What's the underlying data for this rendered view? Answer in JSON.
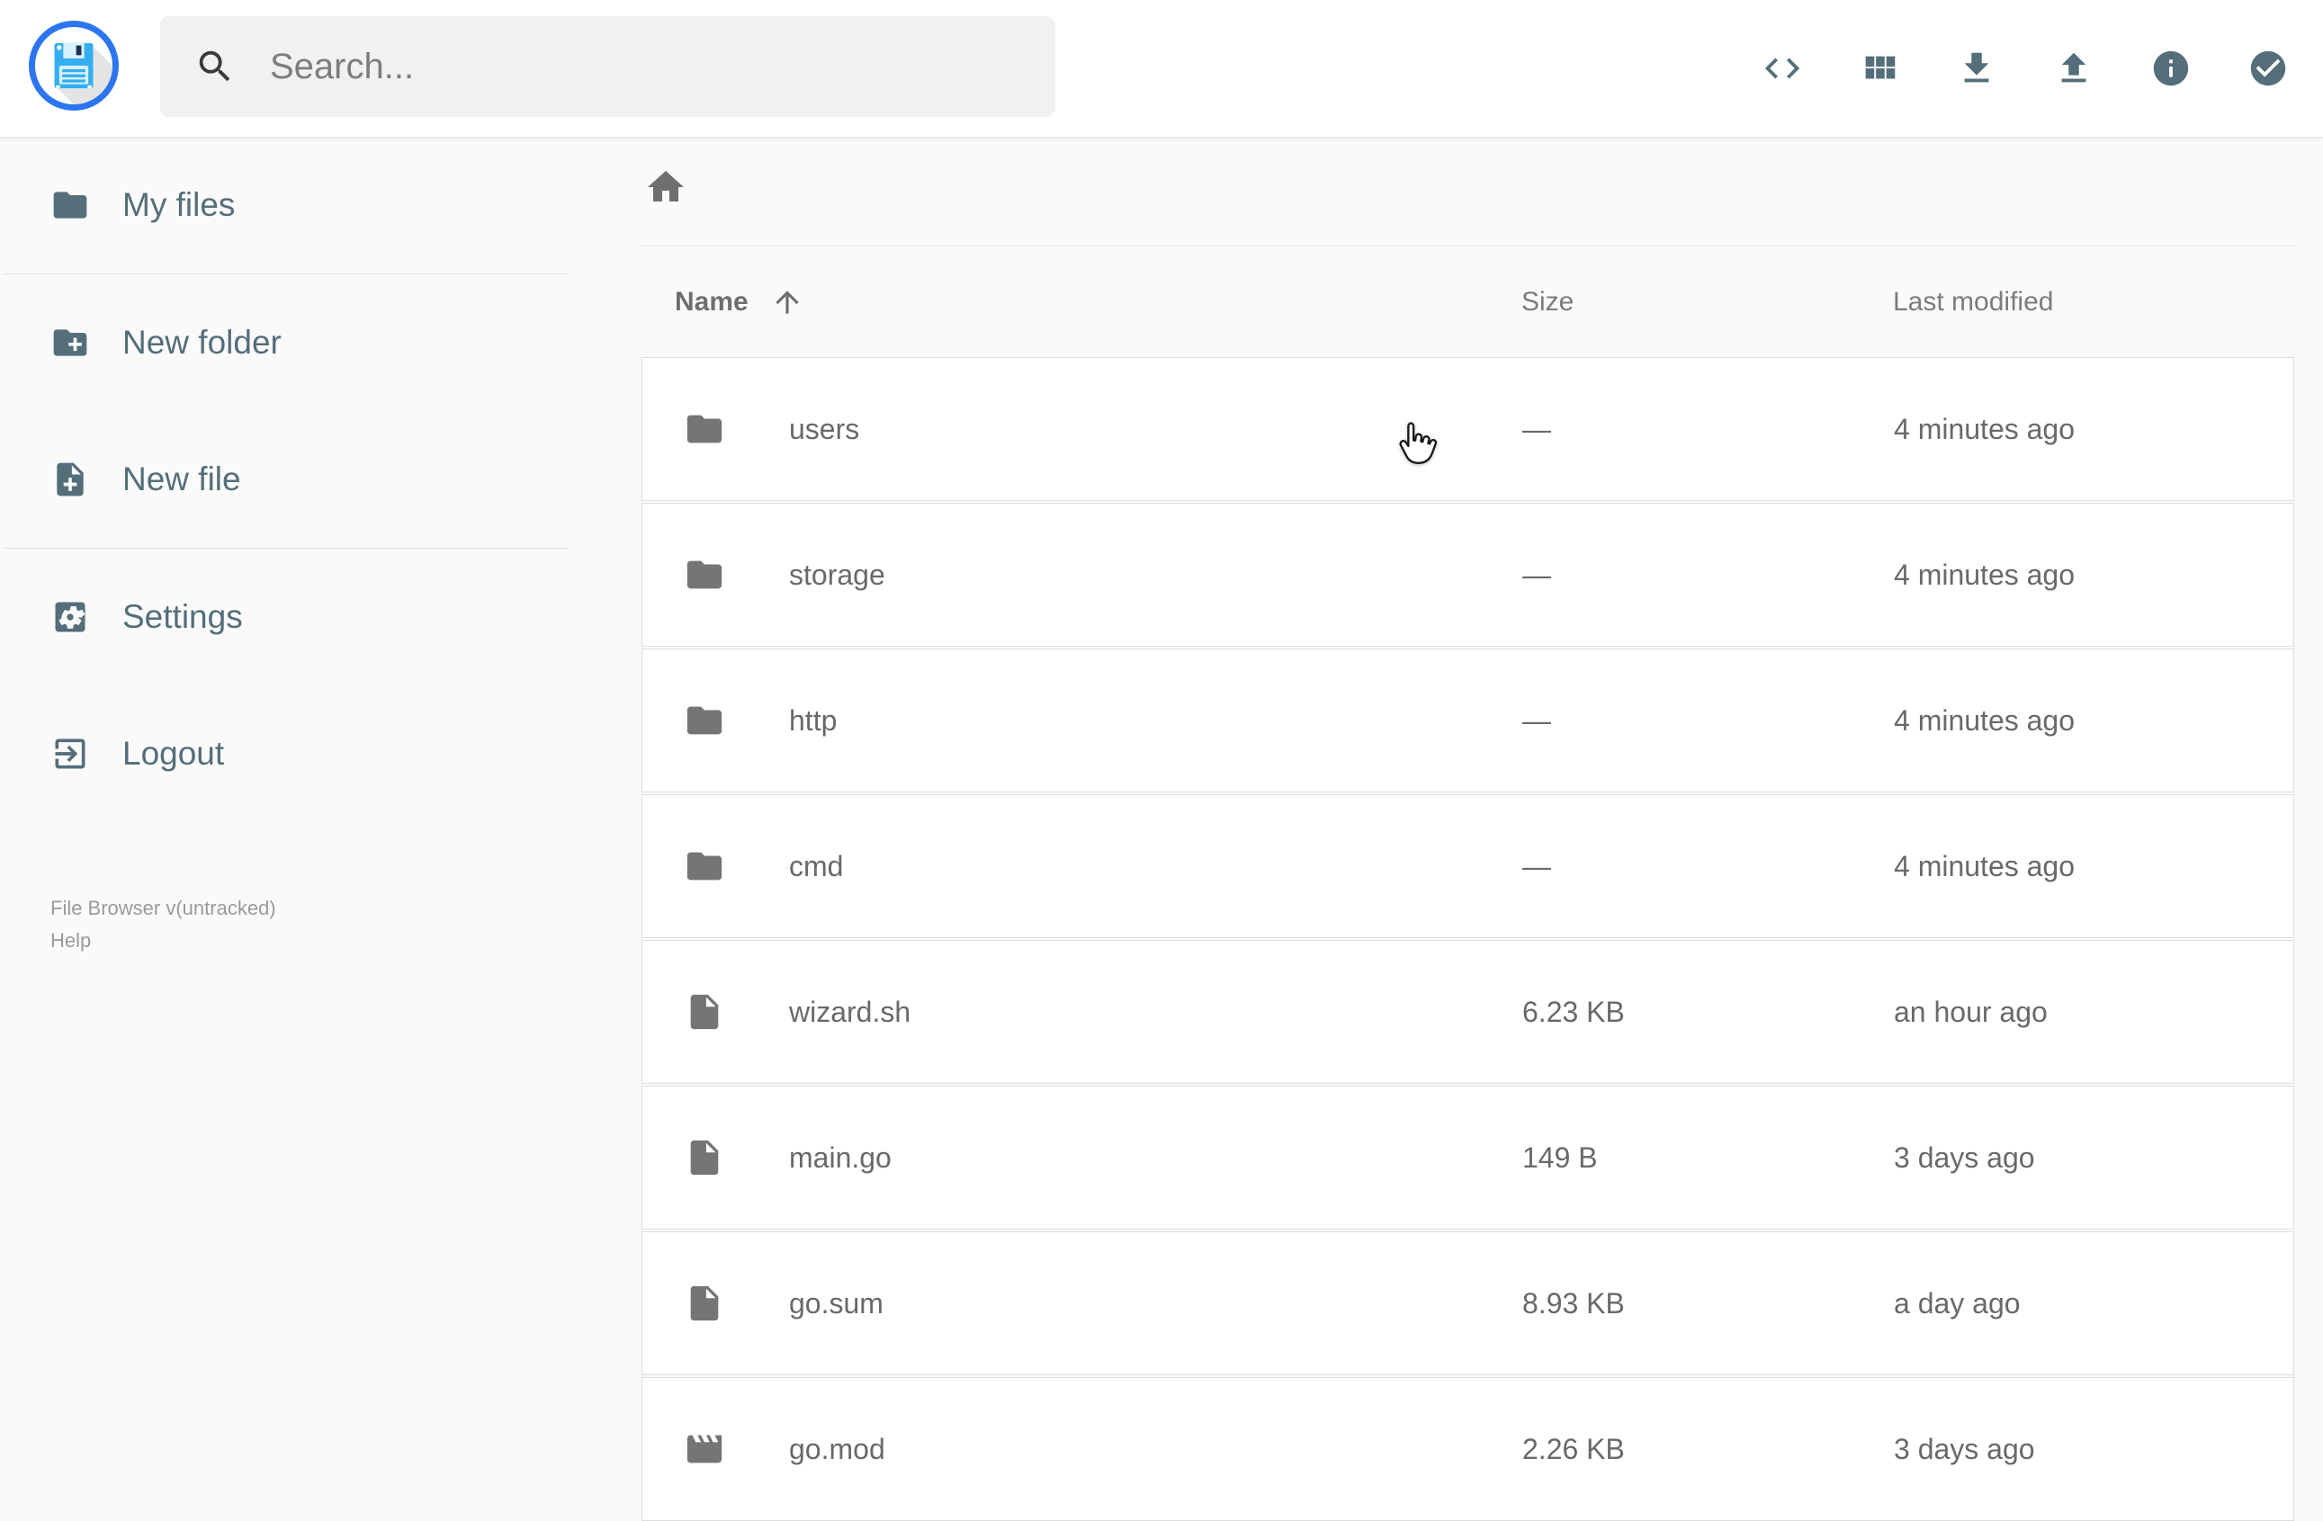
{
  "app": {
    "title": "File Browser"
  },
  "topbar": {
    "search": {
      "placeholder": "Search...",
      "icon": "search-icon"
    },
    "actions": [
      {
        "name": "code-view",
        "icon": "code-icon"
      },
      {
        "name": "switch-view",
        "icon": "grid-view-icon"
      },
      {
        "name": "download",
        "icon": "download-icon"
      },
      {
        "name": "upload",
        "icon": "upload-icon"
      },
      {
        "name": "info",
        "icon": "info-icon"
      },
      {
        "name": "select-multiple",
        "icon": "check-circle-icon"
      }
    ]
  },
  "sidebar": {
    "items": [
      {
        "label": "My files",
        "icon": "folder-icon"
      },
      {
        "label": "New folder",
        "icon": "new-folder-icon"
      },
      {
        "label": "New file",
        "icon": "new-file-icon"
      },
      {
        "label": "Settings",
        "icon": "settings-icon"
      },
      {
        "label": "Logout",
        "icon": "logout-icon"
      }
    ],
    "footer": {
      "version": "File Browser v(untracked)",
      "help_label": "Help"
    }
  },
  "main": {
    "breadcrumb": {
      "home_icon": "home-icon"
    },
    "listing": {
      "columns": [
        {
          "label": "Name",
          "sort": "asc"
        },
        {
          "label": "Size",
          "sort": null
        },
        {
          "label": "Last modified",
          "sort": null
        }
      ],
      "rows": [
        {
          "name": "users",
          "icon": "folder-icon",
          "size": "—",
          "modified": "4 minutes ago"
        },
        {
          "name": "storage",
          "icon": "folder-icon",
          "size": "—",
          "modified": "4 minutes ago"
        },
        {
          "name": "http",
          "icon": "folder-icon",
          "size": "—",
          "modified": "4 minutes ago"
        },
        {
          "name": "cmd",
          "icon": "folder-icon",
          "size": "—",
          "modified": "4 minutes ago"
        },
        {
          "name": "wizard.sh",
          "icon": "file-icon",
          "size": "6.23 KB",
          "modified": "an hour ago"
        },
        {
          "name": "main.go",
          "icon": "file-icon",
          "size": "149 B",
          "modified": "3 days ago"
        },
        {
          "name": "go.sum",
          "icon": "file-icon",
          "size": "8.93 KB",
          "modified": "a day ago"
        },
        {
          "name": "go.mod",
          "icon": "movie-icon",
          "size": "2.26 KB",
          "modified": "3 days ago"
        }
      ]
    }
  },
  "colors": {
    "accent_blue": "#2b76f0",
    "logo_floppy_blue": "#35aeef",
    "slate": "#546e7a",
    "icon_gray": "#757575",
    "text_gray": "#696969",
    "background": "#fafafa"
  }
}
